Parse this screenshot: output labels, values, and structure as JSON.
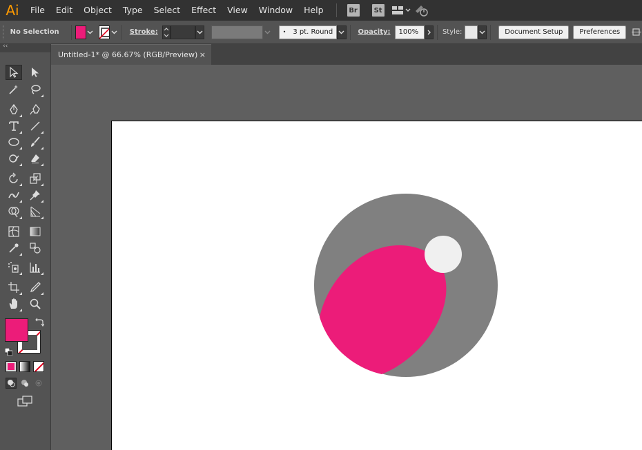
{
  "app": {
    "logo_text": "Ai",
    "menu": [
      "File",
      "Edit",
      "Object",
      "Type",
      "Select",
      "Effect",
      "View",
      "Window",
      "Help"
    ],
    "app_tiles": [
      "Br",
      "St"
    ]
  },
  "controlbar": {
    "selection_status": "No Selection",
    "fill_color": "#EC1C79",
    "stroke_label": "Stroke:",
    "brush_label": "3 pt. Round",
    "opacity_label": "Opacity:",
    "opacity_value": "100%",
    "style_label": "Style:",
    "document_setup": "Document Setup",
    "preferences": "Preferences"
  },
  "document": {
    "tab_title": "Untitled-1* @ 66.67% (RGB/Preview)",
    "close_glyph": "×"
  },
  "tools": {
    "collapse_glyph": "‹‹",
    "fill_color": "#EC1C79",
    "stroke_color": "none"
  },
  "artwork": {
    "outer_circle_color": "#808080",
    "pink_shape_color": "#EC1C79",
    "highlight_color": "#F0F0F0"
  }
}
